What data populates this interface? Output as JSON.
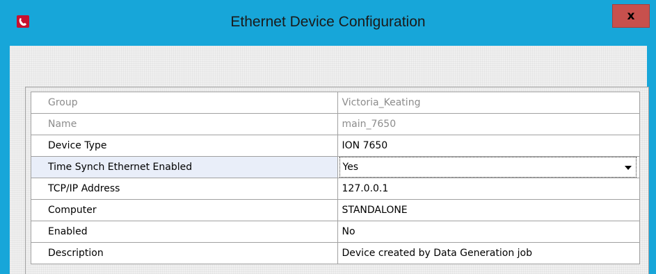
{
  "window": {
    "title": "Ethernet Device Configuration",
    "close_label": "x",
    "accent": "#17a6d9"
  },
  "properties": [
    {
      "label": "Group",
      "value": "Victoria_Keating",
      "state": "disabled"
    },
    {
      "label": "Name",
      "value": "main_7650",
      "state": "disabled"
    },
    {
      "label": "Device Type",
      "value": "ION 7650",
      "state": "normal"
    },
    {
      "label": "Time Synch Ethernet Enabled",
      "value": "Yes",
      "state": "selected-dropdown"
    },
    {
      "label": "TCP/IP Address",
      "value": "127.0.0.1",
      "state": "normal"
    },
    {
      "label": "Computer",
      "value": "STANDALONE",
      "state": "normal"
    },
    {
      "label": "Enabled",
      "value": "No",
      "state": "normal"
    },
    {
      "label": "Description",
      "value": "Device created by Data Generation job",
      "state": "normal"
    }
  ],
  "icons": {
    "app": "phone-handset-icon",
    "close": "close-icon",
    "dropdown": "chevron-down-icon"
  }
}
